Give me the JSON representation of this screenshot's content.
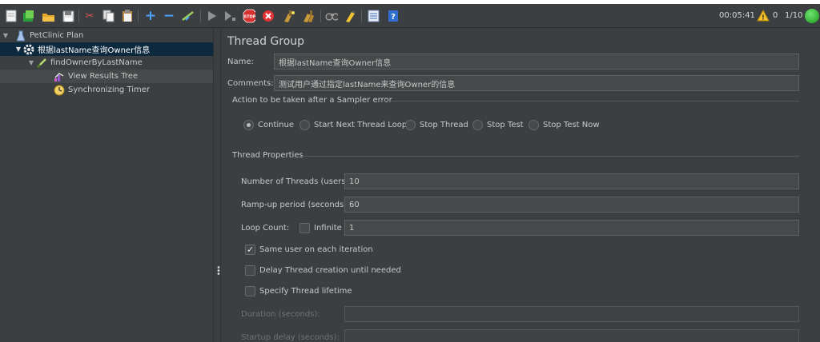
{
  "toolbar": {
    "icons": [
      "new-icon",
      "templates-icon",
      "open-icon",
      "save-icon",
      "cut-icon",
      "copy-icon",
      "paste-icon",
      "expand-icon",
      "collapse-icon",
      "toggle-icon",
      "start-icon",
      "start-no-pauses-icon",
      "stop-icon",
      "shutdown-icon",
      "clear-icon",
      "clear-all-icon",
      "search-icon",
      "reset-search-icon",
      "function-helper-icon",
      "help-icon"
    ],
    "elapsed_time": "00:05:41",
    "warning_count": "0",
    "threads": "1/10",
    "status_color": "#2fbf2f"
  },
  "tree": {
    "items": [
      {
        "label": "PetClinic Plan",
        "icon": "test-plan-icon"
      },
      {
        "label": "根据lastName查询Owner信息",
        "icon": "thread-group-gear-icon"
      },
      {
        "label": "findOwnerByLastName",
        "icon": "http-sampler-icon"
      },
      {
        "label": "View Results Tree",
        "icon": "results-tree-icon"
      },
      {
        "label": "Synchronizing Timer",
        "icon": "timer-icon"
      }
    ]
  },
  "panel": {
    "title": "Thread Group",
    "name_label": "Name:",
    "name_value": "根据lastName查询Owner信息",
    "comments_label": "Comments:",
    "comments_value": "测试用户通过指定lastName来查询Owner的信息",
    "sampler_error": {
      "title": "Action to be taken after a Sampler error",
      "options": [
        "Continue",
        "Start Next Thread Loop",
        "Stop Thread",
        "Stop Test",
        "Stop Test Now"
      ],
      "selected": "Continue"
    },
    "thread_properties": {
      "title": "Thread Properties",
      "threads_label": "Number of Threads (users):",
      "threads_value": "10",
      "rampup_label": "Ramp-up period (seconds):",
      "rampup_value": "60",
      "loop_label": "Loop Count:",
      "infinite_label": "Infinite",
      "loop_value": "1",
      "same_user_label": "Same user on each iteration",
      "delay_label": "Delay Thread creation until needed",
      "lifetime_label": "Specify Thread lifetime",
      "duration_label": "Duration (seconds):",
      "startup_label": "Startup delay (seconds):"
    }
  },
  "colors": {
    "background": "#3c3f41",
    "selection": "#0d293e",
    "field": "#45494a"
  }
}
